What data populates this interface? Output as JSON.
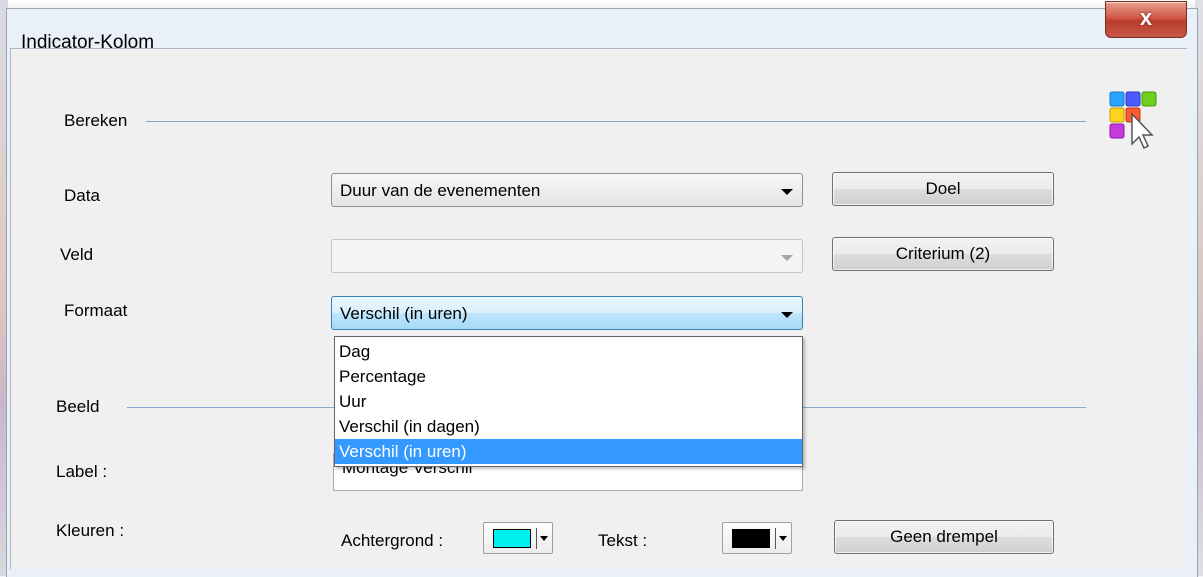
{
  "window": {
    "title": "Indicator-Kolom",
    "close_label": "x"
  },
  "bereken": {
    "section_label": "Bereken",
    "data_label": "Data",
    "data_value": "Duur van de evenementen",
    "veld_label": "Veld",
    "veld_value": "",
    "formaat_label": "Formaat",
    "formaat_value": "Verschil (in uren)",
    "doel_button": "Doel",
    "criterium_button": "Criterium (2)"
  },
  "formaat_options": [
    "Dag",
    "Percentage",
    "Uur",
    "Verschil (in dagen)",
    "Verschil (in uren)"
  ],
  "formaat_selected_index": 4,
  "beeld": {
    "section_label": "Beeld",
    "label_label": "Label :",
    "label_value": "Montage Verschil",
    "kleuren_label": "Kleuren :",
    "achtergrond_label": "Achtergrond :",
    "achtergrond_color": "#00f0f0",
    "tekst_label": "Tekst :",
    "tekst_color": "#000000",
    "drempel_button": "Geen drempel"
  },
  "icons": {
    "app": "color-grid-cursor-icon",
    "close": "close-icon"
  }
}
